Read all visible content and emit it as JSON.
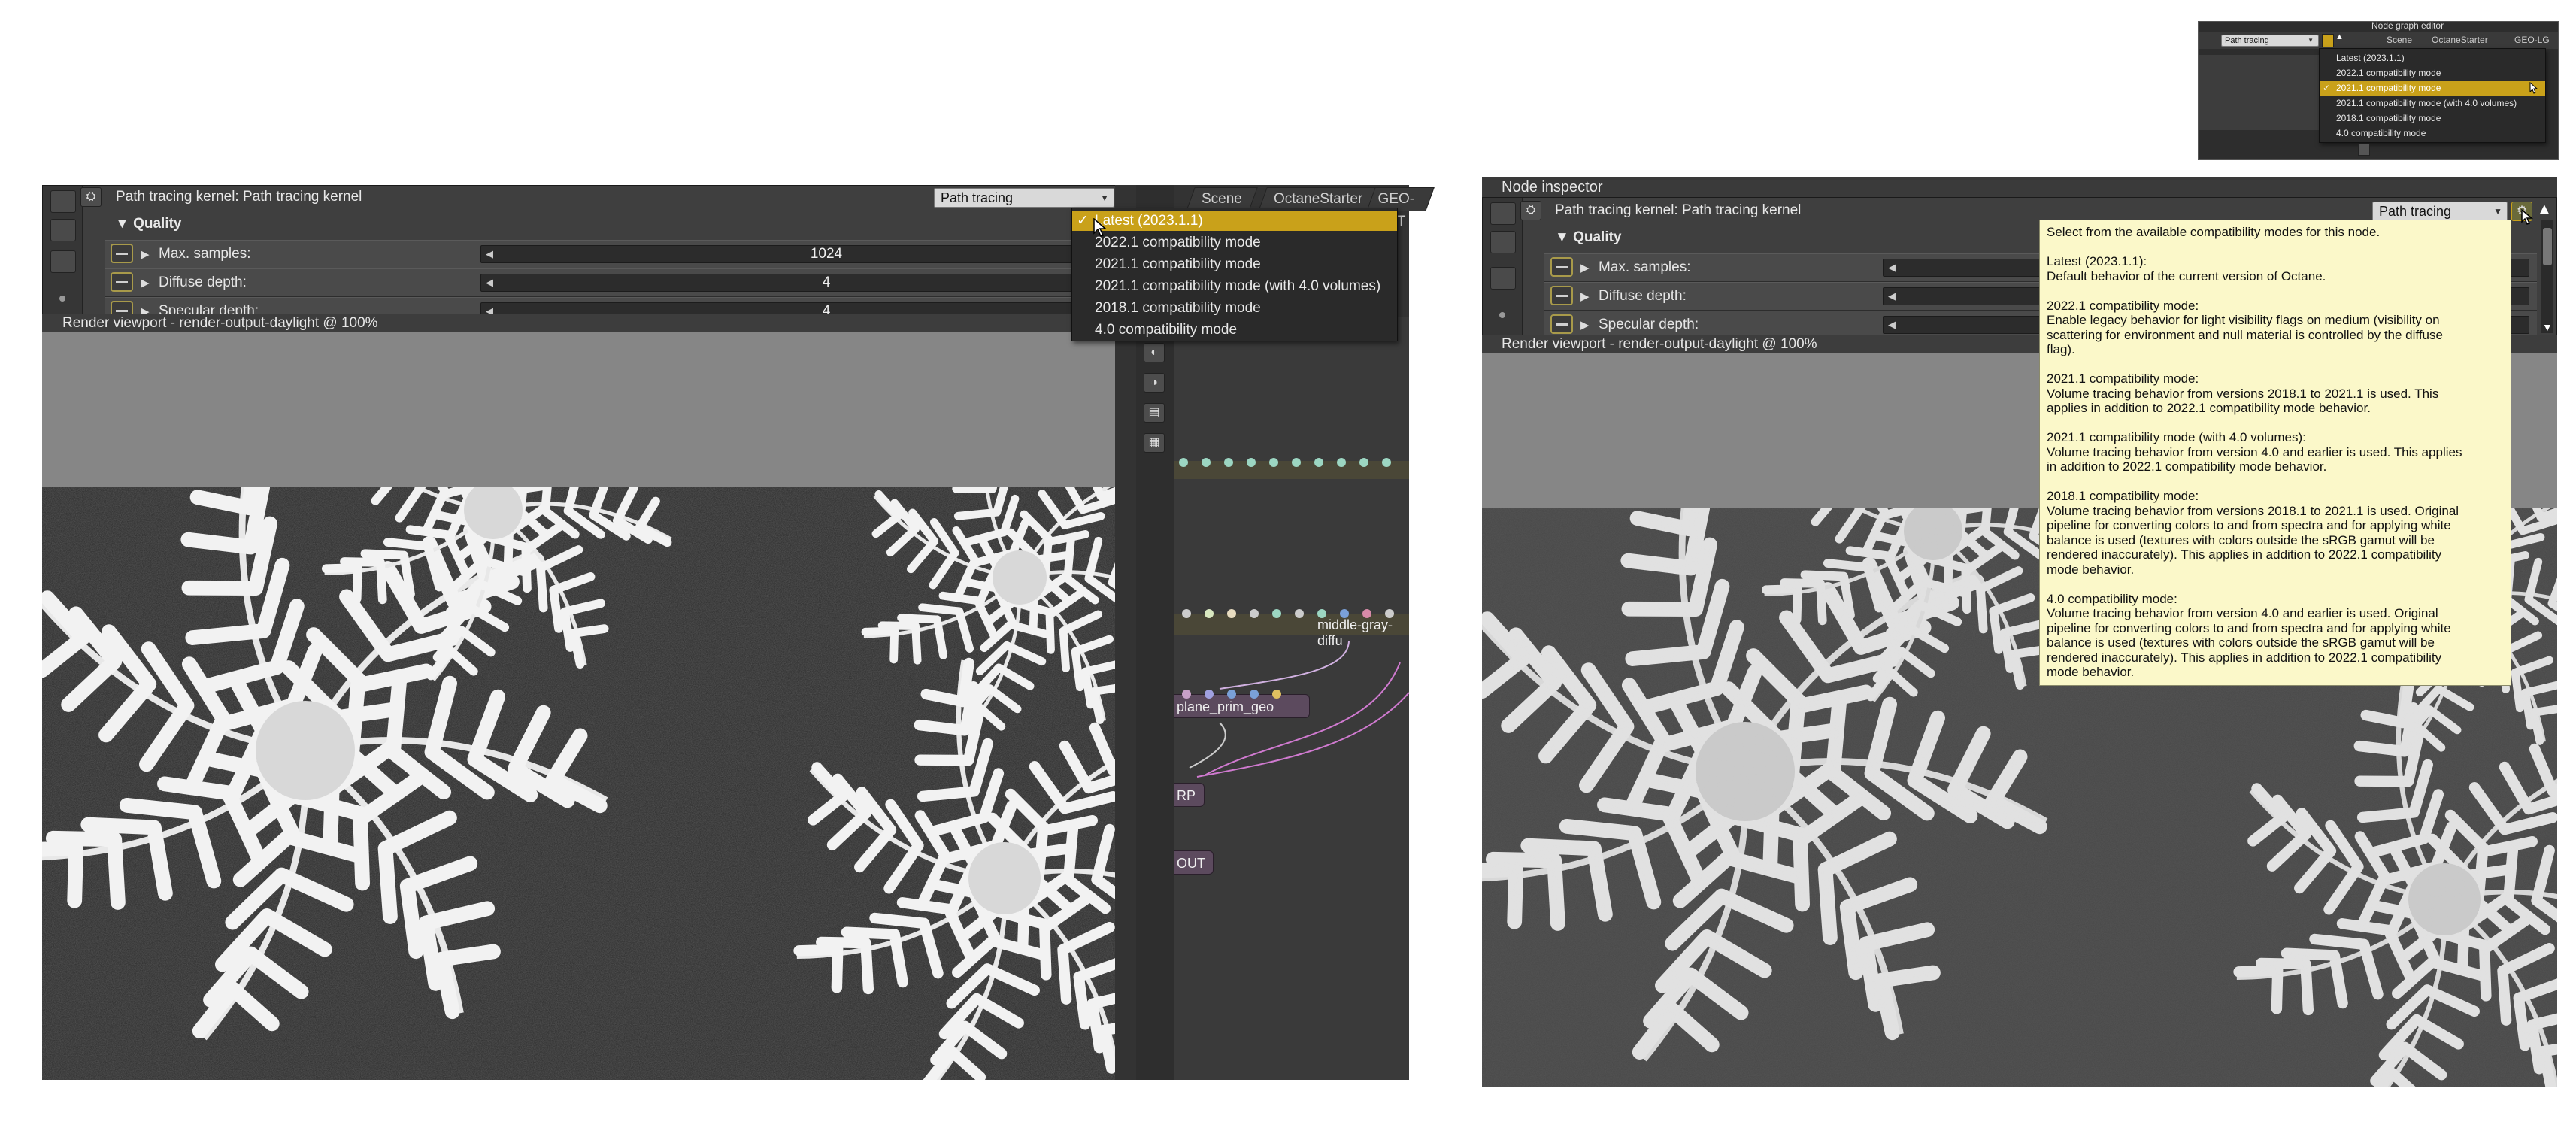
{
  "left": {
    "kernel_title": "Path tracing kernel: Path tracing kernel",
    "kernel_combo": "Path tracing",
    "quality_label": "Quality",
    "params": [
      {
        "label": "Max. samples:",
        "value": "1024"
      },
      {
        "label": "Diffuse depth:",
        "value": "4"
      },
      {
        "label": "Specular depth:",
        "value": "4"
      }
    ],
    "tabs": [
      "Scene",
      "OctaneStarter",
      "GEO-LGT"
    ],
    "viewport_title": "Render viewport - render-output-daylight @ 100%",
    "dropdown": {
      "items": [
        "Latest (2023.1.1)",
        "2022.1 compatibility mode",
        "2021.1 compatibility mode",
        "2021.1 compatibility mode (with 4.0 volumes)",
        "2018.1 compatibility mode",
        "4.0 compatibility mode"
      ],
      "selected_index": 0,
      "checkmark": "✓"
    },
    "nodes": {
      "middle_gray": "middle-gray-diffu",
      "plane_prim": "plane_prim_geo",
      "rp": "RP",
      "out": "OUT"
    }
  },
  "inset": {
    "title": "Node graph editor",
    "combo": "Path tracing",
    "tabs": [
      "Scene",
      "OctaneStarter",
      "GEO-LG"
    ],
    "items": [
      "Latest (2023.1.1)",
      "2022.1 compatibility mode",
      "2021.1 compatibility mode",
      "2021.1 compatibility mode (with 4.0 volumes)",
      "2018.1 compatibility mode",
      "4.0 compatibility mode"
    ],
    "selected_index": 2,
    "checkmark": "✓"
  },
  "right": {
    "panel_title": "Node inspector",
    "kernel_title": "Path tracing kernel: Path tracing kernel",
    "kernel_combo": "Path tracing",
    "quality_label": "Quality",
    "params": [
      {
        "label": "Max. samples:"
      },
      {
        "label": "Diffuse depth:"
      },
      {
        "label": "Specular depth:"
      }
    ],
    "viewport_title": "Render viewport - render-output-daylight @ 100%",
    "tooltip": {
      "intro": "Select from the available compatibility modes for this node.",
      "entries": [
        {
          "title": "Latest (2023.1.1):",
          "body": "Default behavior of the current version of Octane."
        },
        {
          "title": "2022.1 compatibility mode:",
          "body": "Enable legacy behavior for light visibility flags on medium (visibility on\nscattering for environment and null material is controlled by the diffuse\nflag)."
        },
        {
          "title": "2021.1 compatibility mode:",
          "body": "Volume tracing behavior from versions 2018.1 to 2021.1 is used. This\napplies in addition to 2022.1 compatibility mode behavior."
        },
        {
          "title": "2021.1 compatibility mode (with 4.0 volumes):",
          "body": "Volume tracing behavior from version 4.0 and earlier is used. This applies\nin addition to 2022.1 compatibility mode behavior."
        },
        {
          "title": "2018.1 compatibility mode:",
          "body": "Volume tracing behavior from versions 2018.1 to 2021.1 is used. Original\npipeline for converting colors to and from spectra and for applying white\nbalance is used (textures with colors outside the sRGB gamut will be\nrendered inaccurately). This applies in addition to 2022.1 compatibility\nmode behavior."
        },
        {
          "title": "4.0 compatibility mode:",
          "body": "Volume tracing behavior from version 4.0 and earlier is used. Original\npipeline for converting colors to and from spectra and for applying white\nbalance is used (textures with colors outside the sRGB gamut will be\nrendered inaccurately). This applies in addition to 2022.1 compatibility\nmode behavior."
        }
      ]
    }
  },
  "colors": {
    "panel_bg": "#3f3f3f",
    "selection_gold": "#c9a11a",
    "tooltip_bg": "#fbf8c9",
    "node_purple": "#5c4a5e",
    "wire_pink": "#d07ad0"
  },
  "icons": [
    "render-icon",
    "settings-icon",
    "image-icon",
    "dot-icon",
    "eject-icon",
    "compatibility-icon",
    "node-icon"
  ]
}
